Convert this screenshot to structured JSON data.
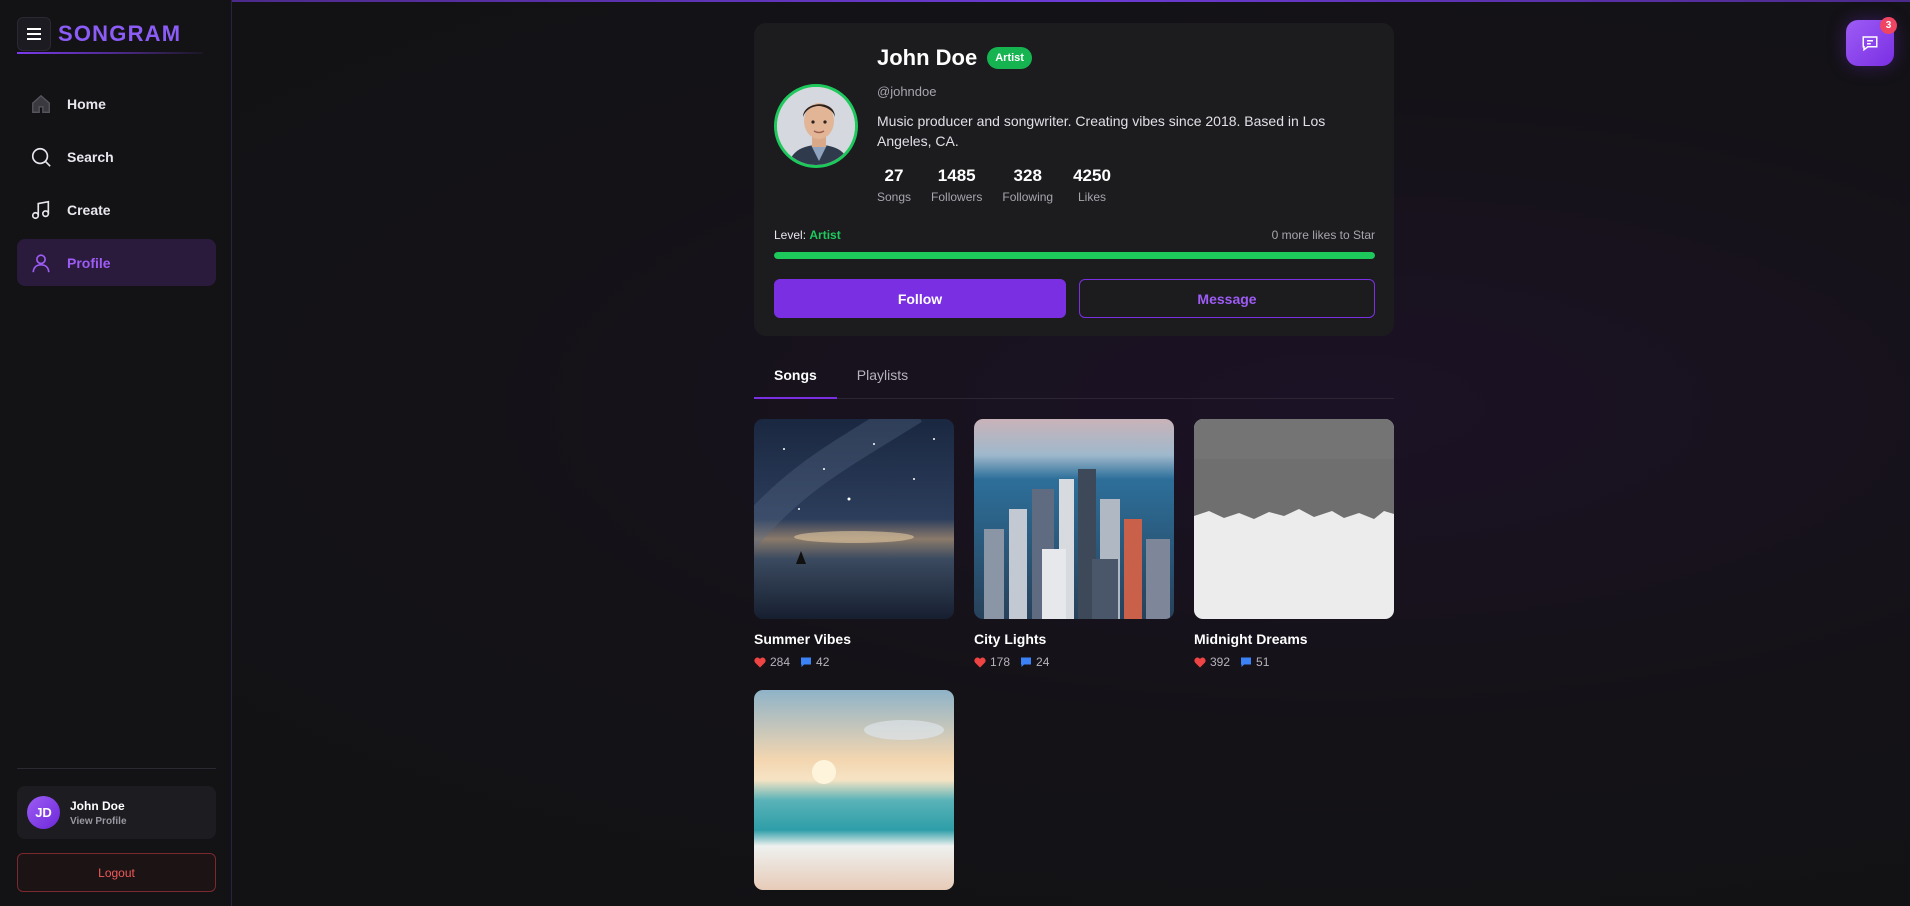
{
  "app": {
    "brand": "SONGRAM"
  },
  "sidebar": {
    "items": [
      {
        "label": "Home",
        "icon": "home-icon"
      },
      {
        "label": "Search",
        "icon": "search-icon"
      },
      {
        "label": "Create",
        "icon": "music-note-icon"
      },
      {
        "label": "Profile",
        "icon": "user-icon",
        "active": true
      }
    ],
    "user": {
      "initials": "JD",
      "name": "John Doe",
      "link": "View Profile"
    },
    "logout_label": "Logout"
  },
  "profile": {
    "name": "John Doe",
    "badge": "Artist",
    "handle": "@johndoe",
    "bio": "Music producer and songwriter. Creating vibes since 2018. Based in Los Angeles, CA.",
    "stats": [
      {
        "value": "27",
        "label": "Songs"
      },
      {
        "value": "1485",
        "label": "Followers"
      },
      {
        "value": "328",
        "label": "Following"
      },
      {
        "value": "4250",
        "label": "Likes"
      }
    ],
    "level_label": "Level:",
    "level_value": "Artist",
    "level_next": "0 more likes to Star",
    "level_progress_percent": 100,
    "follow_label": "Follow",
    "message_label": "Message"
  },
  "tabs": [
    {
      "label": "Songs",
      "active": true
    },
    {
      "label": "Playlists",
      "active": false
    }
  ],
  "songs": [
    {
      "title": "Summer Vibes",
      "likes": "284",
      "comments": "42",
      "cover": "night-sky-lake"
    },
    {
      "title": "City Lights",
      "likes": "178",
      "comments": "24",
      "cover": "city-skyline"
    },
    {
      "title": "Midnight Dreams",
      "likes": "392",
      "comments": "51",
      "cover": "white-paint-texture"
    },
    {
      "title": "",
      "likes": "",
      "comments": "",
      "cover": "beach-sunset"
    }
  ],
  "chat": {
    "badge_count": "3",
    "icon": "chat-icon"
  },
  "colors": {
    "accent": "#7a2fe3",
    "success": "#1ec95c",
    "danger": "#ef4462"
  }
}
